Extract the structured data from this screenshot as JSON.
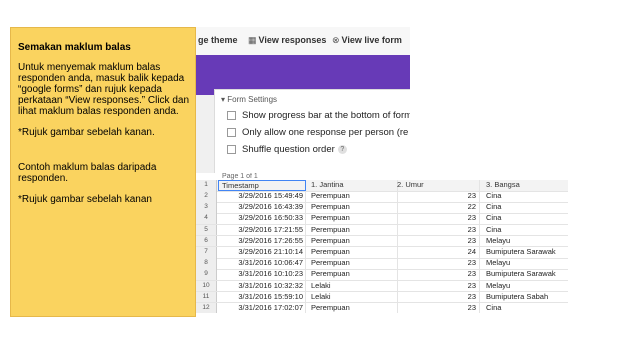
{
  "callout": {
    "title": "Semakan maklum balas",
    "para1": "Untuk menyemak maklum balas responden anda, masuk balik kepada “google forms” dan rujuk kepada perkataan “View responses.” Click dan lihat maklum balas responden anda.",
    "note1": "*Rujuk gambar sebelah kanan.",
    "para2": "Contoh maklum balas daripada responden.",
    "note2": "*Rujuk gambar sebelah kanan"
  },
  "forms": {
    "toolbar": {
      "theme_label": "ge theme",
      "view_responses_label": "View responses",
      "view_live_label": "View live form"
    },
    "settings": {
      "header": "▾ Form Settings",
      "options": [
        "Show progress bar at the bottom of form",
        "Only allow one response per person (re",
        "Shuffle question order"
      ],
      "help": "?"
    },
    "accent_color": "#673ab7"
  },
  "sheet": {
    "page_label": "Page 1 of 1",
    "header": {
      "num": "1",
      "ts": "Timestamp",
      "j": "1. Jantina",
      "u": "2. Umur",
      "b": "3. Bangsa"
    },
    "rows": [
      {
        "num": "2",
        "ts": "3/29/2016 15:49:49",
        "j": "Perempuan",
        "u": "23",
        "b": "Cina"
      },
      {
        "num": "3",
        "ts": "3/29/2016 16:43:39",
        "j": "Perempuan",
        "u": "22",
        "b": "Cina"
      },
      {
        "num": "4",
        "ts": "3/29/2016 16:50:33",
        "j": "Perempuan",
        "u": "23",
        "b": "Cina"
      },
      {
        "num": "5",
        "ts": "3/29/2016 17:21:55",
        "j": "Perempuan",
        "u": "23",
        "b": "Cina"
      },
      {
        "num": "6",
        "ts": "3/29/2016 17:26:55",
        "j": "Perempuan",
        "u": "23",
        "b": "Melayu"
      },
      {
        "num": "7",
        "ts": "3/29/2016 21:10:14",
        "j": "Perempuan",
        "u": "24",
        "b": "Bumiputera Sarawak"
      },
      {
        "num": "8",
        "ts": "3/31/2016 10:06:47",
        "j": "Perempuan",
        "u": "23",
        "b": "Melayu"
      },
      {
        "num": "9",
        "ts": "3/31/2016 10:10:23",
        "j": "Perempuan",
        "u": "23",
        "b": "Bumiputera Sarawak"
      },
      {
        "num": "10",
        "ts": "3/31/2016 10:32:32",
        "j": "Lelaki",
        "u": "23",
        "b": "Melayu"
      },
      {
        "num": "11",
        "ts": "3/31/2016 15:59:10",
        "j": "Lelaki",
        "u": "23",
        "b": "Bumiputera Sabah"
      },
      {
        "num": "12",
        "ts": "3/31/2016 17:02:07",
        "j": "Perempuan",
        "u": "23",
        "b": "Cina"
      }
    ]
  }
}
